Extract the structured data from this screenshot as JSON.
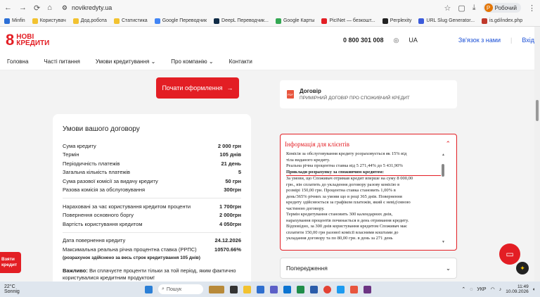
{
  "browser": {
    "url": "novikredyty.ua",
    "profile_label": "Робочий",
    "profile_initial": "Р"
  },
  "bookmarks": [
    "Minfin",
    "Користувач",
    "Дод.робота",
    "Статистика",
    "Google Переводчик",
    "DeepL Переводчик...",
    "Google Карты",
    "PicINet — безкошт...",
    "Perplexity",
    "URL Slug Generator...",
    "is.gd/index.php"
  ],
  "header": {
    "logo_line1": "НОВІ",
    "logo_line2": "КРЕДИТИ",
    "phone": "0 800 301 008",
    "lang": "UA",
    "contact_link": "Зв'язок з нами",
    "login_link": "Вхід"
  },
  "nav": [
    "Головна",
    "Часті питання",
    "Умови кредитування",
    "Про компанію",
    "Контакти"
  ],
  "cta": {
    "label": "Почати оформлення"
  },
  "contract": {
    "title": "Умови вашого договору",
    "group1": [
      {
        "label": "Сума кредиту",
        "value": "2 000 грн"
      },
      {
        "label": "Термін",
        "value": "105 днів"
      },
      {
        "label": "Періодичність платежів",
        "value": "21 день"
      },
      {
        "label": "Загальна кількість платежів",
        "value": "5"
      },
      {
        "label": "Сума разової комісії за видачу кредиту",
        "value": "50 грн"
      },
      {
        "label": "Разова комісія за обслуговування",
        "value": "300грн"
      }
    ],
    "group2": [
      {
        "label": "Нараховані за час користування кредитом проценти",
        "value": "1 700грн"
      },
      {
        "label": "Повернення основного боргу",
        "value": "2 000грн"
      },
      {
        "label": "Вартість користування кредитом",
        "value": "4 050грн"
      }
    ],
    "group3": [
      {
        "label": "Дата повернення кредиту",
        "value": "24.12.2026"
      },
      {
        "label": "Максимальна реальна річна процентна ставка (РРПС)",
        "value": "10570.66%"
      }
    ],
    "note": "(розрахунок здійснено за весь строк кредитування 105 днів)",
    "important_bold": "Важливо:",
    "important_text": " Ви сплачуєте проценти тільки за той період, яким фактично користувалися кредитним продуктом!"
  },
  "document": {
    "icon": "PDF",
    "title": "Договір",
    "subtitle": "ПРИМІРНИЙ ДОГОВІР ПРО СПОЖИВЧИЙ КРЕДИТ"
  },
  "info": {
    "title": "Інформація для клієнтів",
    "lines": [
      "Комісія за обслуговування кредиту розраховується як 15% від",
      "тіла виданого кредиту.",
      "Реальна річна процентна ставка від 5 271,44% до 5 431,90%",
      "Приклади розрахунку за споживчим кредитом:",
      "За умови, що Споживач отримав кредит вперше на суму 8 000,00",
      "грн., він сплатить до укладення договору разову комісію в",
      "розмірі 150,00 грн. Процентна ставка становить 1,00% в",
      "день/365% річних за умови що в році 365 днів. Повернення",
      "кредиту здійснюється за графіком платежів, який є невід'ємною",
      "частиною договору.",
      "Термін кредитування становить 300 календарних днів,",
      "нарахування процентів починається в день отримання кредиту.",
      "Відповідно, за 300 днів користування кредитом Споживач має",
      "сплатити 150,00 грн разової комісії власними коштами до",
      "укладання договору та по 80,00 грн. в день за 271 день"
    ]
  },
  "warnings": {
    "title": "Попередження"
  },
  "side_button": {
    "line1": "Взяти",
    "line2": "кредит"
  },
  "taskbar": {
    "temp": "22°C",
    "weather": "Sonnig",
    "search_placeholder": "Пошук",
    "lang": "УКР",
    "time": "11:49",
    "date": "10.09.2026"
  },
  "colors": {
    "brand_red": "#e31e24",
    "link_blue": "#1a4fd6"
  }
}
